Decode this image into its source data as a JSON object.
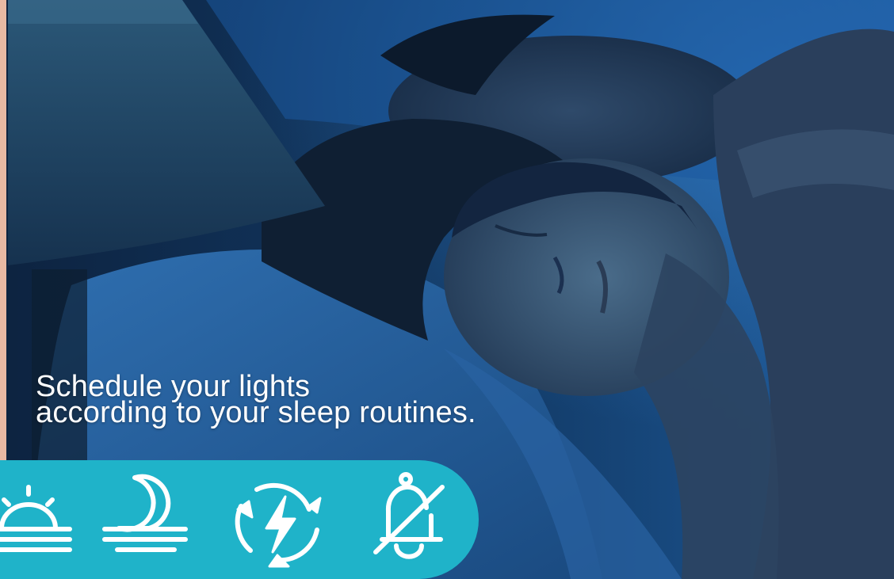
{
  "caption": {
    "line1": "Schedule your lights",
    "line2": "according to your sleep routines."
  },
  "icons": [
    "sunrise-icon",
    "moonset-icon",
    "energy-cycle-icon",
    "alarm-off-icon"
  ],
  "colors": {
    "icon_bar": "#1fb3c9",
    "icon_stroke": "#ffffff",
    "caption_text": "#ffffff"
  }
}
